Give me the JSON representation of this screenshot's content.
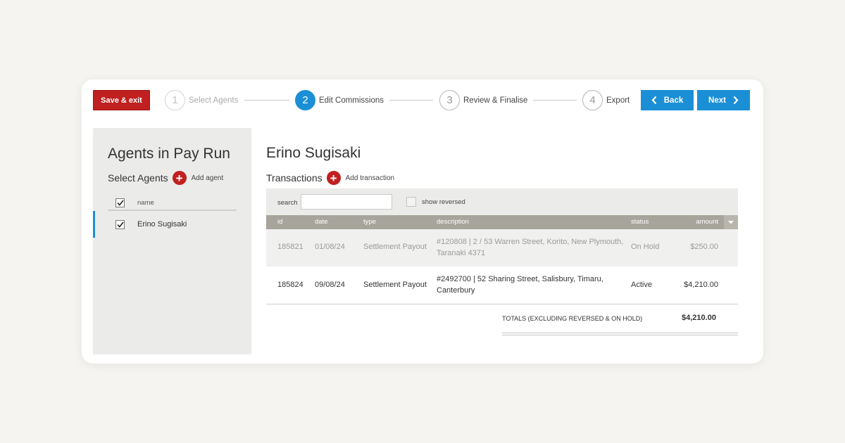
{
  "toolbar": {
    "save_exit": "Save & exit",
    "back": "Back",
    "next": "Next"
  },
  "steps": [
    {
      "num": "1",
      "label": "Select Agents",
      "state": "done"
    },
    {
      "num": "2",
      "label": "Edit Commissions",
      "state": "active"
    },
    {
      "num": "3",
      "label": "Review & Finalise",
      "state": "upcoming"
    },
    {
      "num": "4",
      "label": "Export",
      "state": "upcoming"
    }
  ],
  "sidebar": {
    "title": "Agents in Pay Run",
    "subtitle": "Select Agents",
    "add_label": "Add agent",
    "column_name": "name",
    "agents": [
      {
        "name": "Erino Sugisaki",
        "checked": true
      }
    ]
  },
  "main": {
    "agent_name": "Erino Sugisaki",
    "transactions_label": "Transactions",
    "add_label": "Add transaction",
    "search_label": "search",
    "search_value": "",
    "show_reversed_label": "show reversed",
    "columns": {
      "id": "id",
      "date": "date",
      "type": "type",
      "description": "description",
      "status": "status",
      "amount": "amount"
    },
    "rows": [
      {
        "id": "185821",
        "date": "01/08/24",
        "type": "Settlement Payout",
        "description": "#120808 | 2 / 53 Warren Street, Korito, New Plymouth, Taranaki 4371",
        "status": "On Hold",
        "amount": "$250.00"
      },
      {
        "id": "185824",
        "date": "09/08/24",
        "type": "Settlement Payout",
        "description": "#2492700 | 52 Sharing Street, Salisbury, Timaru, Canterbury",
        "status": "Active",
        "amount": "$4,210.00"
      }
    ],
    "totals_label": "TOTALS (EXCLUDING REVERSED & ON HOLD)",
    "totals_value": "$4,210.00"
  },
  "colors": {
    "brand_red": "#c0201f",
    "accent_blue": "#1b8fd6",
    "table_header": "#a7a49b"
  }
}
